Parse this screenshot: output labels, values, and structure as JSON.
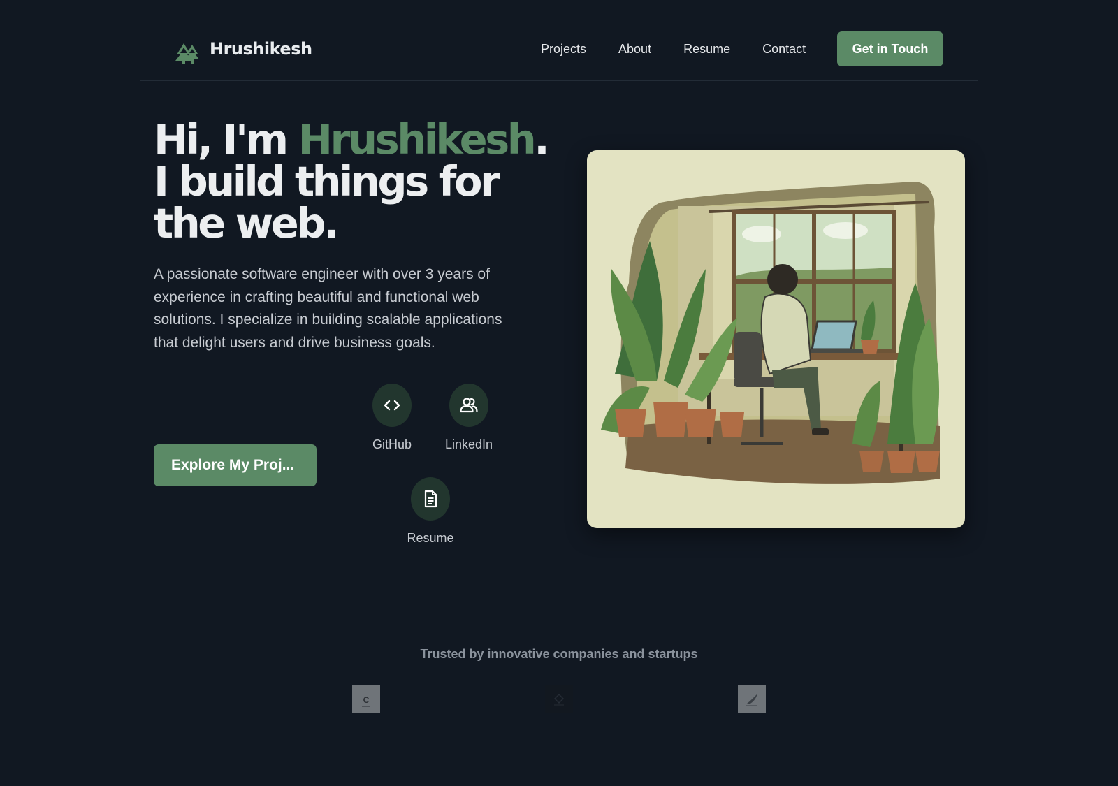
{
  "brand": {
    "name": "Hrushikesh",
    "logo_icon": "pine-trees-icon"
  },
  "nav": {
    "items": [
      "Projects",
      "About",
      "Resume",
      "Contact"
    ],
    "cta_label": "Get in Touch"
  },
  "hero": {
    "title_prefix": "Hi, I'm ",
    "title_name": "Hrushikesh",
    "title_period": ".",
    "title_line2": "I build things for",
    "title_line3": "the web.",
    "description": "A passionate software engineer with over 3 years of experience in crafting beautiful and functional web solutions. I specialize in building scalable applications that delight users and drive business goals.",
    "explore_label": "Explore My Proj..."
  },
  "social": [
    {
      "label": "GitHub",
      "icon": "code-brackets-icon"
    },
    {
      "label": "LinkedIn",
      "icon": "users-icon"
    },
    {
      "label": "Resume",
      "icon": "document-icon"
    }
  ],
  "illustration": {
    "icon": "developer-at-desk-illustration"
  },
  "trusted": {
    "heading": "Trusted by innovative companies and startups",
    "logos": [
      "company-logo-c",
      "company-logo-dark",
      "company-logo-bird"
    ]
  },
  "colors": {
    "background": "#111822",
    "accent": "#5b8a66",
    "text": "#e6e8eb",
    "muted": "#8a929c",
    "icon_circle": "#22362e",
    "illustration_bg": "#e3e3c2"
  }
}
